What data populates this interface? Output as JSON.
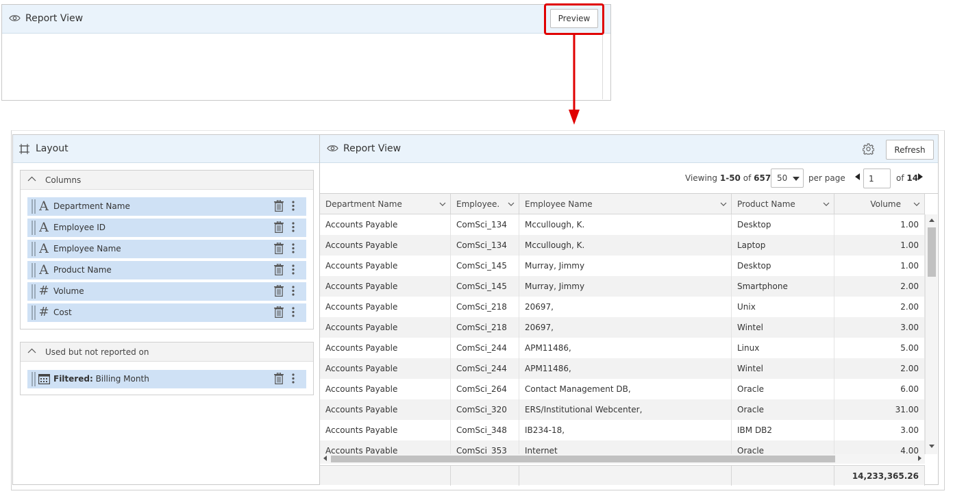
{
  "preview_panel": {
    "title": "Report View",
    "preview_label": "Preview",
    "highlight_color": "#e00000"
  },
  "layout": {
    "title": "Layout",
    "columns_group": {
      "label": "Columns",
      "fields": [
        {
          "type": "text",
          "type_icon": "A",
          "name": "Department Name"
        },
        {
          "type": "text",
          "type_icon": "A",
          "name": "Employee ID"
        },
        {
          "type": "text",
          "type_icon": "A",
          "name": "Employee Name"
        },
        {
          "type": "text",
          "type_icon": "A",
          "name": "Product Name"
        },
        {
          "type": "number",
          "type_icon": "#",
          "name": "Volume"
        },
        {
          "type": "number",
          "type_icon": "#",
          "name": "Cost"
        }
      ]
    },
    "used_group": {
      "label": "Used but not reported on",
      "fields": [
        {
          "type": "date",
          "prefix": "Filtered:",
          "name": "Billing Month"
        }
      ]
    }
  },
  "report": {
    "title": "Report View",
    "refresh_label": "Refresh",
    "pager": {
      "viewing_prefix": "Viewing",
      "range": "1-50",
      "of_word": "of",
      "total": "657",
      "per_page_value": "50",
      "per_page_label": "per page",
      "page_value": "1",
      "pages_prefix": "of",
      "page_count": "14"
    },
    "columns": [
      "Department Name",
      "Employee...",
      "Employee Name",
      "Product Name",
      "Volume"
    ],
    "rows": [
      [
        "Accounts Payable",
        "ComSci_134",
        "Mccullough, K.",
        "Desktop",
        "1.00"
      ],
      [
        "Accounts Payable",
        "ComSci_134",
        "Mccullough, K.",
        "Laptop",
        "1.00"
      ],
      [
        "Accounts Payable",
        "ComSci_145",
        "Murray, Jimmy",
        "Desktop",
        "1.00"
      ],
      [
        "Accounts Payable",
        "ComSci_145",
        "Murray, Jimmy",
        "Smartphone",
        "2.00"
      ],
      [
        "Accounts Payable",
        "ComSci_218",
        "20697,",
        "Unix",
        "2.00"
      ],
      [
        "Accounts Payable",
        "ComSci_218",
        "20697,",
        "Wintel",
        "3.00"
      ],
      [
        "Accounts Payable",
        "ComSci_244",
        "APM11486,",
        "Linux",
        "5.00"
      ],
      [
        "Accounts Payable",
        "ComSci_244",
        "APM11486,",
        "Wintel",
        "2.00"
      ],
      [
        "Accounts Payable",
        "ComSci_264",
        "Contact Management DB,",
        "Oracle",
        "6.00"
      ],
      [
        "Accounts Payable",
        "ComSci_320",
        "ERS/Institutional Webcenter,",
        "Oracle",
        "31.00"
      ],
      [
        "Accounts Payable",
        "ComSci_348",
        "IB234-18,",
        "IBM DB2",
        "3.00"
      ],
      [
        "Accounts Payable",
        "ComSci_353",
        "Internet",
        "Oracle",
        "4.00"
      ]
    ],
    "footer_total": "14,233,365.26"
  }
}
